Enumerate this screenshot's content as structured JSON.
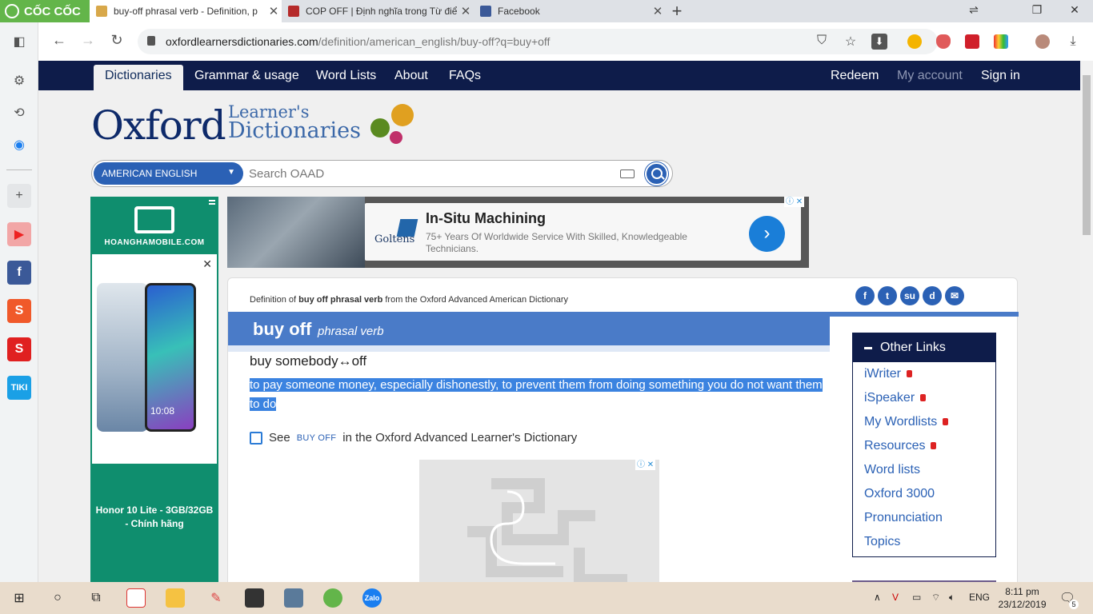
{
  "browser": {
    "name": "CỐC CỐC",
    "tabs": [
      {
        "title": "buy-off phrasal verb - Definition, p",
        "active": true
      },
      {
        "title": "COP OFF | Định nghĩa trong Từ điể",
        "active": false
      },
      {
        "title": "Facebook",
        "active": false
      }
    ],
    "url_host": "oxfordlearnersdictionaries.com",
    "url_path": "/definition/american_english/buy-off?q=buy+off"
  },
  "site_nav": {
    "items": [
      "Dictionaries",
      "Grammar & usage",
      "Word Lists",
      "About",
      "FAQs"
    ],
    "right": [
      "Redeem",
      "My account",
      "Sign in"
    ]
  },
  "logo": {
    "main": "Oxford",
    "line1": "Learner's",
    "line2": "Dictionaries"
  },
  "search": {
    "dictionary": "AMERICAN ENGLISH",
    "placeholder": "Search OAAD"
  },
  "left_ad": {
    "brand": "HOANGHAMOBILE.COM",
    "phone_time": "10:08",
    "caption_line1": "Honor 10 Lite - 3GB/32GB",
    "caption_line2": "- Chính hãng"
  },
  "banner_ad": {
    "advertiser": "Goltens",
    "title": "In-Situ Machining",
    "text": "75+ Years Of Worldwide Service With Skilled, Knowledgeable Technicians."
  },
  "entry": {
    "crumb_prefix": "Definition of",
    "crumb_word": "buy off phrasal verb",
    "crumb_suffix": "from the Oxford Advanced American Dictionary",
    "headword": "buy off",
    "pos": "phrasal verb",
    "phrase": "buy somebody↔off",
    "definition": "to pay someone money, especially dishonestly, to prevent them from doing something you do not want them to do",
    "see_prefix": "See",
    "see_term": "BUY OFF",
    "see_suffix": "in the Oxford Advanced Learner's Dictionary"
  },
  "other_links": {
    "title": "Other Links",
    "items": [
      {
        "label": "iWriter",
        "locked": true
      },
      {
        "label": "iSpeaker",
        "locked": true
      },
      {
        "label": "My Wordlists",
        "locked": true
      },
      {
        "label": "Resources",
        "locked": true
      },
      {
        "label": "Word lists",
        "locked": false
      },
      {
        "label": "Oxford 3000",
        "locked": false
      },
      {
        "label": "Pronunciation",
        "locked": false
      },
      {
        "label": "Topics",
        "locked": false
      }
    ]
  },
  "taskbar": {
    "language": "ENG",
    "time": "8:11 pm",
    "date": "23/12/2019",
    "notification_count": "5"
  },
  "colors": {
    "oxford_navy": "#0e1c4a",
    "oxford_blue": "#4a7bc8",
    "selection": "#3b83e0",
    "coccoc_green": "#63b54a"
  }
}
